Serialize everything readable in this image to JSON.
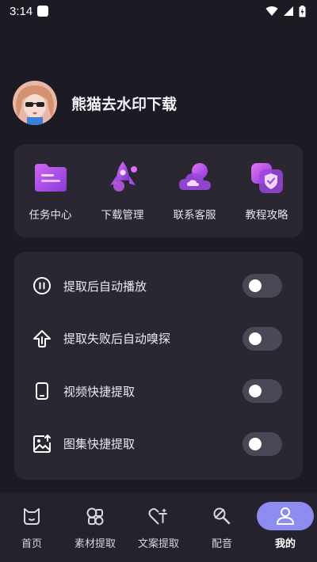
{
  "status_bar": {
    "time": "3:14"
  },
  "profile": {
    "name": "熊猫去水印下载"
  },
  "quick_actions": [
    {
      "label": "任务中心",
      "icon": "folder-icon"
    },
    {
      "label": "下载管理",
      "icon": "rocket-icon"
    },
    {
      "label": "联系客服",
      "icon": "cloud-icon"
    },
    {
      "label": "教程攻略",
      "icon": "shield-icon"
    }
  ],
  "settings": [
    {
      "label": "提取后自动播放",
      "icon": "pause-circle-icon",
      "enabled": false
    },
    {
      "label": "提取失败后自动嗅探",
      "icon": "upload-icon",
      "enabled": false
    },
    {
      "label": "视频快捷提取",
      "icon": "phone-icon",
      "enabled": false
    },
    {
      "label": "图集快捷提取",
      "icon": "image-icon",
      "enabled": false
    }
  ],
  "bottom_nav": [
    {
      "label": "首页",
      "icon": "home-icon",
      "active": false
    },
    {
      "label": "素材提取",
      "icon": "shapes-icon",
      "active": false
    },
    {
      "label": "文案提取",
      "icon": "text-heart-icon",
      "active": false
    },
    {
      "label": "配音",
      "icon": "mic-icon",
      "active": false
    },
    {
      "label": "我的",
      "icon": "user-icon",
      "active": true
    }
  ],
  "colors": {
    "background": "#1c1a22",
    "card": "#2a2733",
    "accent": "#8d8cf0",
    "icon_purple": "#b04fe0",
    "toggle_off": "#4a4756"
  }
}
